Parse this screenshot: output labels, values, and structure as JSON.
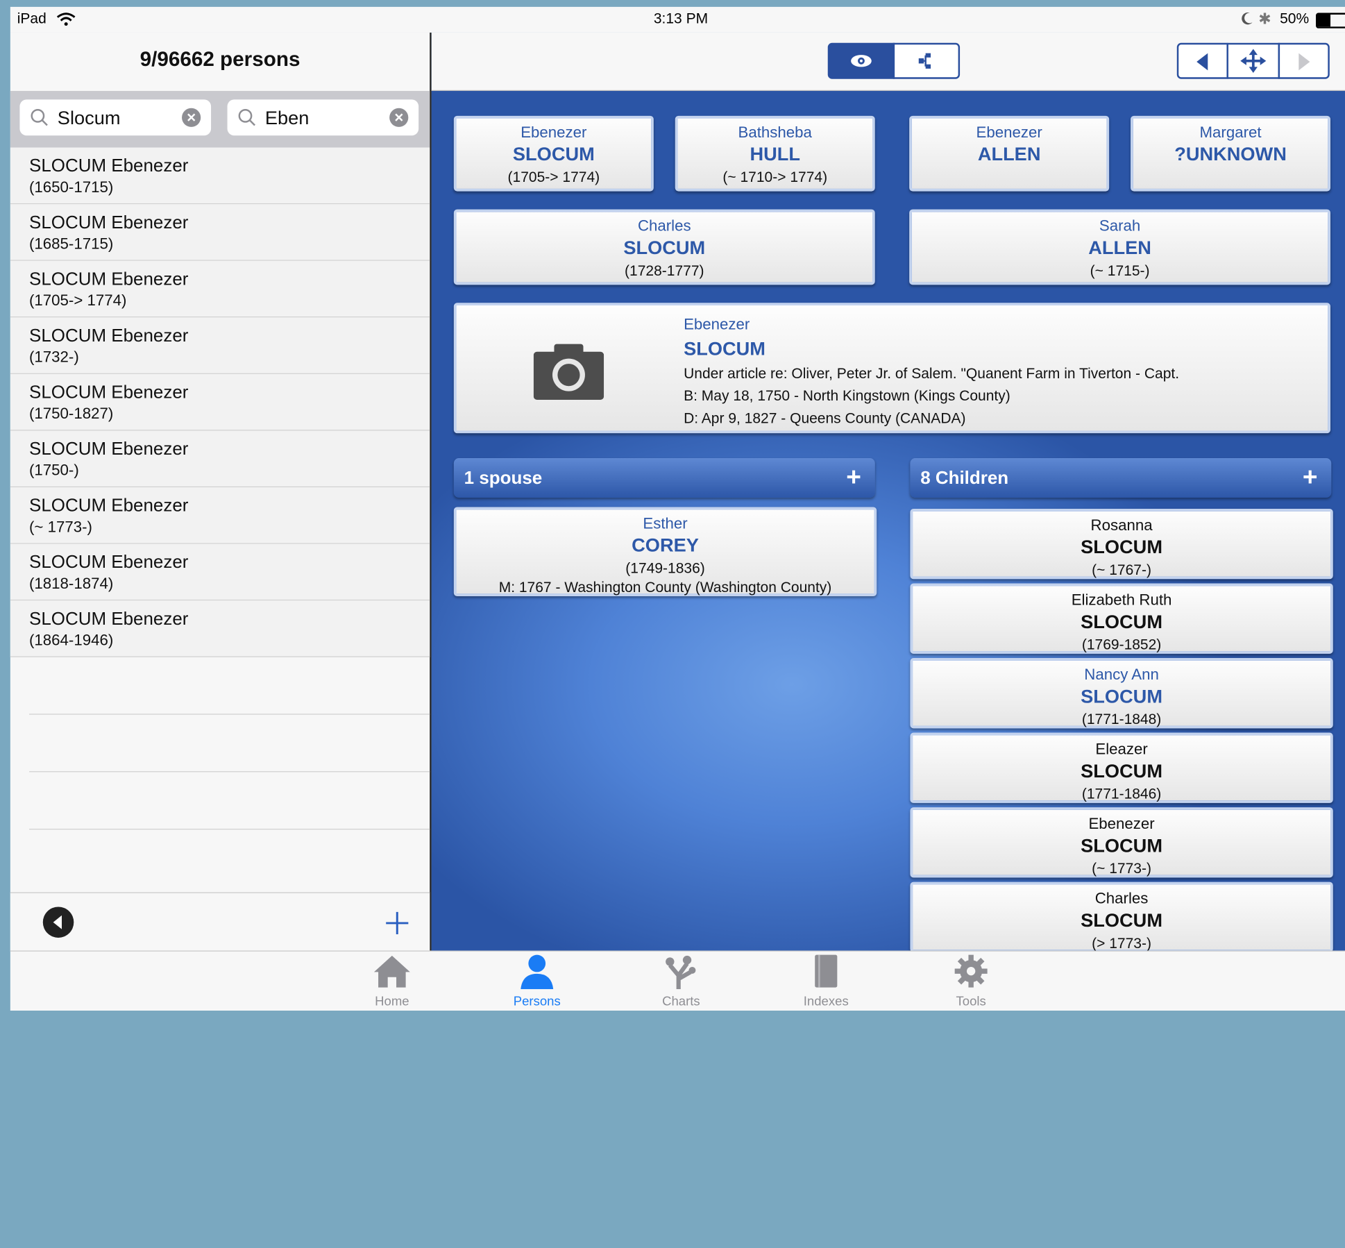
{
  "status": {
    "device": "iPad",
    "time": "3:13 PM",
    "battery": "50%"
  },
  "left": {
    "title": "9/96662 persons",
    "search1": "Slocum",
    "search2": "Eben",
    "persons": [
      {
        "name": "SLOCUM Ebenezer",
        "dates": "(1650-1715)"
      },
      {
        "name": "SLOCUM Ebenezer",
        "dates": "(1685-1715)"
      },
      {
        "name": "SLOCUM Ebenezer",
        "dates": "(1705-> 1774)"
      },
      {
        "name": "SLOCUM Ebenezer",
        "dates": "(1732-)"
      },
      {
        "name": "SLOCUM Ebenezer",
        "dates": "(1750-1827)"
      },
      {
        "name": "SLOCUM Ebenezer",
        "dates": "(1750-)"
      },
      {
        "name": "SLOCUM Ebenezer",
        "dates": "(~ 1773-)"
      },
      {
        "name": "SLOCUM Ebenezer",
        "dates": "(1818-1874)"
      },
      {
        "name": "SLOCUM Ebenezer",
        "dates": "(1864-1946)"
      }
    ]
  },
  "grandparents": [
    {
      "first": "Ebenezer",
      "last": "SLOCUM",
      "dates": "(1705-> 1774)"
    },
    {
      "first": "Bathsheba",
      "last": "HULL",
      "dates": "(~ 1710-> 1774)"
    },
    {
      "first": "Ebenezer",
      "last": "ALLEN",
      "dates": ""
    },
    {
      "first": "Margaret",
      "last": "?UNKNOWN",
      "dates": ""
    }
  ],
  "parents": [
    {
      "first": "Charles",
      "last": "SLOCUM",
      "dates": "(1728-1777)"
    },
    {
      "first": "Sarah",
      "last": "ALLEN",
      "dates": "(~ 1715-)"
    }
  ],
  "person": {
    "first": "Ebenezer",
    "last": "SLOCUM",
    "note": "Under article re: Oliver, Peter Jr. of Salem.  \"Quanent Farm in Tiverton - Capt.",
    "birth": "B: May 18, 1750 - North Kingstown (Kings County)",
    "death": "D: Apr 9, 1827 - Queens County (CANADA)"
  },
  "spouses": {
    "title": "1 spouse",
    "items": [
      {
        "first": "Esther",
        "last": "COREY",
        "dates": "(1749-1836)",
        "marriage": "M: 1767 - Washington County (Washington County)"
      }
    ]
  },
  "children": {
    "title": "8 Children",
    "items": [
      {
        "first": "Rosanna",
        "last": "SLOCUM",
        "dates": "(~ 1767-)"
      },
      {
        "first": "Elizabeth Ruth",
        "last": "SLOCUM",
        "dates": "(1769-1852)"
      },
      {
        "first": "Nancy Ann",
        "last": "SLOCUM",
        "dates": "(1771-1848)"
      },
      {
        "first": "Eleazer",
        "last": "SLOCUM",
        "dates": "(1771-1846)"
      },
      {
        "first": "Ebenezer",
        "last": "SLOCUM",
        "dates": "(~ 1773-)"
      },
      {
        "first": "Charles",
        "last": "SLOCUM",
        "dates": "(> 1773-)"
      }
    ]
  },
  "tabs": [
    {
      "label": "Home",
      "icon": "home-icon"
    },
    {
      "label": "Persons",
      "icon": "person-icon"
    },
    {
      "label": "Charts",
      "icon": "tree-icon"
    },
    {
      "label": "Indexes",
      "icon": "book-icon"
    },
    {
      "label": "Tools",
      "icon": "gear-icon"
    }
  ],
  "colors": {
    "accent": "#2d58a8",
    "tab_active": "#1a7cf5",
    "panel_blue": "#4f82d6"
  }
}
